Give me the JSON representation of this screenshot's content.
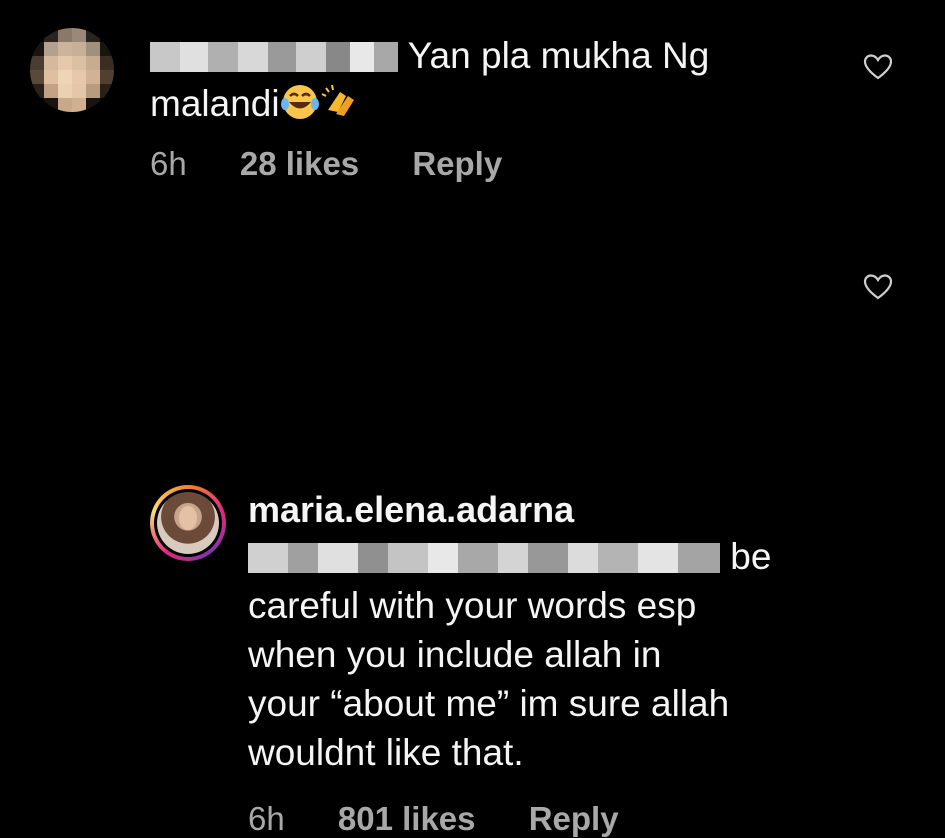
{
  "comment1": {
    "text_line1": "Yan pla mukha Ng",
    "text_line2": "malandi",
    "emojis": [
      "laughing-crying-emoji",
      "clapping-hands-emoji"
    ],
    "time": "6h",
    "likes": "28 likes",
    "reply": "Reply"
  },
  "comment2": {
    "username": "maria.elena.adarna",
    "text_suffix": "be",
    "text_lines": [
      "careful with your words esp",
      "when you include allah in",
      "your “about me” im sure allah",
      "wouldnt like that."
    ],
    "time": "6h",
    "likes": "801 likes",
    "reply": "Reply"
  },
  "colors": {
    "background": "#000000",
    "text": "#f5f5f5",
    "meta": "#a8a8a8"
  }
}
